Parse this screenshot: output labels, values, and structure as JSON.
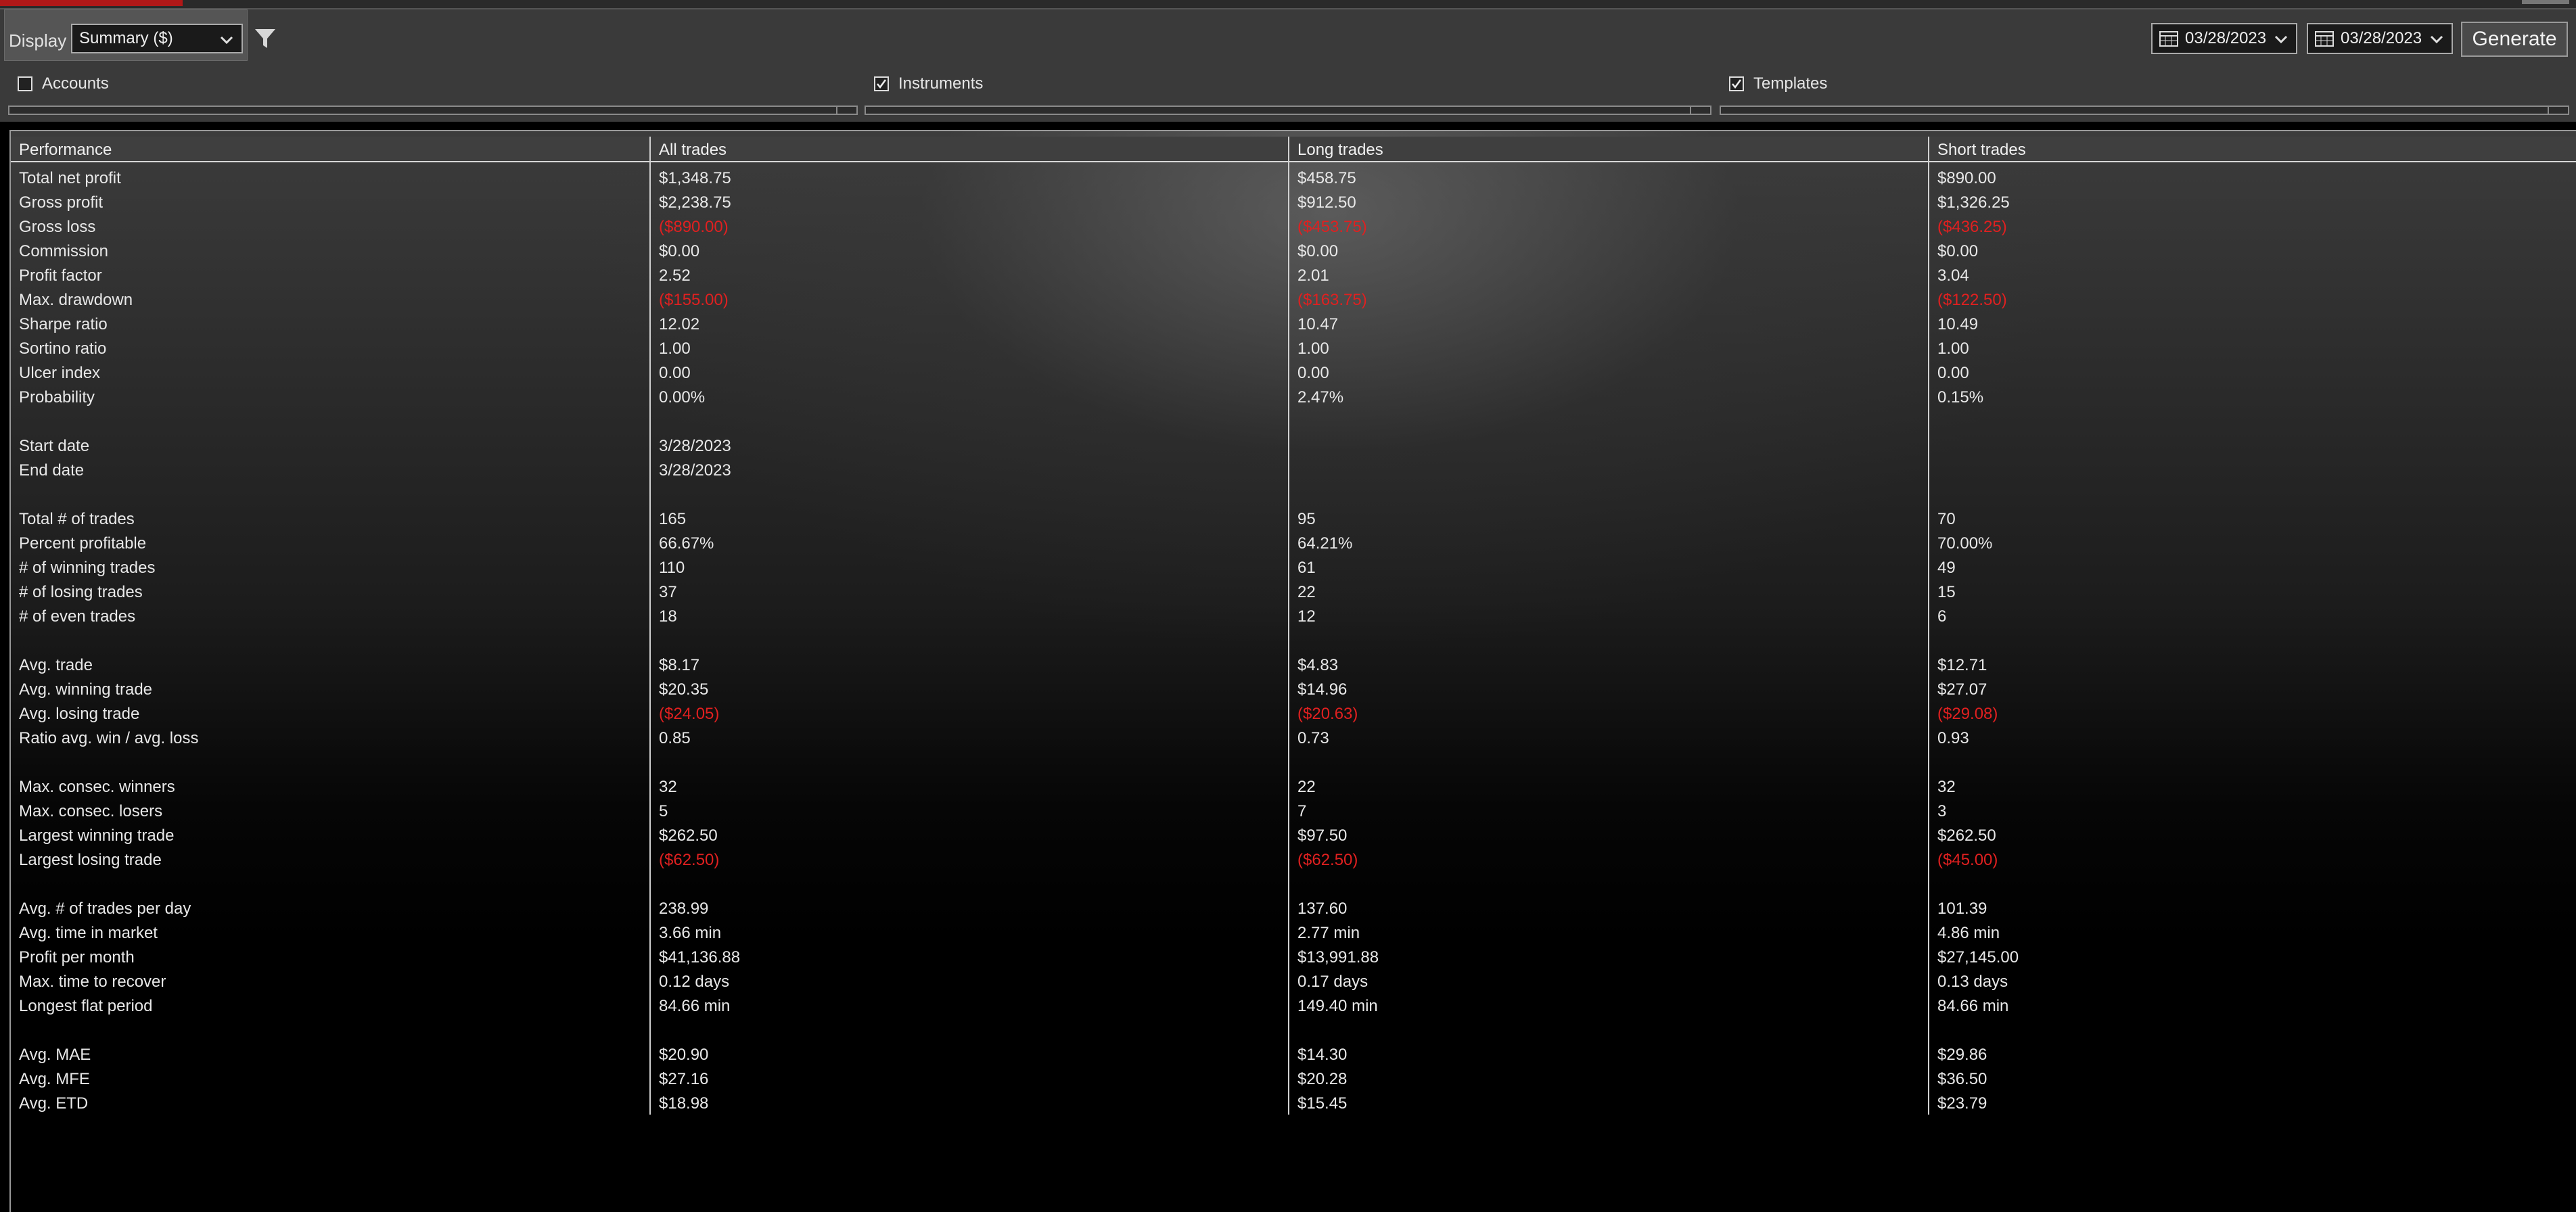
{
  "toolbar": {
    "display_label": "Display",
    "display_value": "Summary ($)",
    "date_from": "03/28/2023",
    "date_to": "03/28/2023",
    "generate_label": "Generate"
  },
  "filters": [
    {
      "label": "Accounts",
      "checked": false
    },
    {
      "label": "Instruments",
      "checked": true
    },
    {
      "label": "Templates",
      "checked": true
    }
  ],
  "grid": {
    "columns": [
      "Performance",
      "All trades",
      "Long trades",
      "Short trades"
    ],
    "rows": [
      {
        "label": "Total net profit",
        "cells": [
          {
            "v": "$1,348.75"
          },
          {
            "v": "$458.75"
          },
          {
            "v": "$890.00"
          }
        ]
      },
      {
        "label": "Gross profit",
        "cells": [
          {
            "v": "$2,238.75"
          },
          {
            "v": "$912.50"
          },
          {
            "v": "$1,326.25"
          }
        ]
      },
      {
        "label": "Gross loss",
        "cells": [
          {
            "v": "($890.00)",
            "neg": true
          },
          {
            "v": "($453.75)",
            "neg": true
          },
          {
            "v": "($436.25)",
            "neg": true
          }
        ]
      },
      {
        "label": "Commission",
        "cells": [
          {
            "v": "$0.00"
          },
          {
            "v": "$0.00"
          },
          {
            "v": "$0.00"
          }
        ]
      },
      {
        "label": "Profit factor",
        "cells": [
          {
            "v": "2.52"
          },
          {
            "v": "2.01"
          },
          {
            "v": "3.04"
          }
        ]
      },
      {
        "label": "Max. drawdown",
        "cells": [
          {
            "v": "($155.00)",
            "neg": true
          },
          {
            "v": "($163.75)",
            "neg": true
          },
          {
            "v": "($122.50)",
            "neg": true
          }
        ]
      },
      {
        "label": "Sharpe ratio",
        "cells": [
          {
            "v": "12.02"
          },
          {
            "v": "10.47"
          },
          {
            "v": "10.49"
          }
        ]
      },
      {
        "label": "Sortino ratio",
        "cells": [
          {
            "v": "1.00"
          },
          {
            "v": "1.00"
          },
          {
            "v": "1.00"
          }
        ]
      },
      {
        "label": "Ulcer index",
        "cells": [
          {
            "v": "0.00"
          },
          {
            "v": "0.00"
          },
          {
            "v": "0.00"
          }
        ]
      },
      {
        "label": "Probability",
        "cells": [
          {
            "v": "0.00%"
          },
          {
            "v": "2.47%"
          },
          {
            "v": "0.15%"
          }
        ]
      },
      {
        "label": "",
        "cells": [
          {
            "v": ""
          },
          {
            "v": ""
          },
          {
            "v": ""
          }
        ]
      },
      {
        "label": "Start date",
        "cells": [
          {
            "v": "3/28/2023"
          },
          {
            "v": ""
          },
          {
            "v": ""
          }
        ]
      },
      {
        "label": "End date",
        "cells": [
          {
            "v": "3/28/2023"
          },
          {
            "v": ""
          },
          {
            "v": ""
          }
        ]
      },
      {
        "label": "",
        "cells": [
          {
            "v": ""
          },
          {
            "v": ""
          },
          {
            "v": ""
          }
        ]
      },
      {
        "label": "Total # of trades",
        "cells": [
          {
            "v": "165"
          },
          {
            "v": "95"
          },
          {
            "v": "70"
          }
        ]
      },
      {
        "label": "Percent profitable",
        "cells": [
          {
            "v": "66.67%"
          },
          {
            "v": "64.21%"
          },
          {
            "v": "70.00%"
          }
        ]
      },
      {
        "label": "# of winning trades",
        "cells": [
          {
            "v": "110"
          },
          {
            "v": "61"
          },
          {
            "v": "49"
          }
        ]
      },
      {
        "label": "# of losing trades",
        "cells": [
          {
            "v": "37"
          },
          {
            "v": "22"
          },
          {
            "v": "15"
          }
        ]
      },
      {
        "label": "# of even trades",
        "cells": [
          {
            "v": "18"
          },
          {
            "v": "12"
          },
          {
            "v": "6"
          }
        ]
      },
      {
        "label": "",
        "cells": [
          {
            "v": ""
          },
          {
            "v": ""
          },
          {
            "v": ""
          }
        ]
      },
      {
        "label": "Avg. trade",
        "cells": [
          {
            "v": "$8.17"
          },
          {
            "v": "$4.83"
          },
          {
            "v": "$12.71"
          }
        ]
      },
      {
        "label": "Avg. winning trade",
        "cells": [
          {
            "v": "$20.35"
          },
          {
            "v": "$14.96"
          },
          {
            "v": "$27.07"
          }
        ]
      },
      {
        "label": "Avg. losing trade",
        "cells": [
          {
            "v": "($24.05)",
            "neg": true
          },
          {
            "v": "($20.63)",
            "neg": true
          },
          {
            "v": "($29.08)",
            "neg": true
          }
        ]
      },
      {
        "label": "Ratio avg. win / avg. loss",
        "cells": [
          {
            "v": "0.85"
          },
          {
            "v": "0.73"
          },
          {
            "v": "0.93"
          }
        ]
      },
      {
        "label": "",
        "cells": [
          {
            "v": ""
          },
          {
            "v": ""
          },
          {
            "v": ""
          }
        ]
      },
      {
        "label": "Max. consec. winners",
        "cells": [
          {
            "v": "32"
          },
          {
            "v": "22"
          },
          {
            "v": "32"
          }
        ]
      },
      {
        "label": "Max. consec. losers",
        "cells": [
          {
            "v": "5"
          },
          {
            "v": "7"
          },
          {
            "v": "3"
          }
        ]
      },
      {
        "label": "Largest winning trade",
        "cells": [
          {
            "v": "$262.50"
          },
          {
            "v": "$97.50"
          },
          {
            "v": "$262.50"
          }
        ]
      },
      {
        "label": "Largest losing trade",
        "cells": [
          {
            "v": "($62.50)",
            "neg": true
          },
          {
            "v": "($62.50)",
            "neg": true
          },
          {
            "v": "($45.00)",
            "neg": true
          }
        ]
      },
      {
        "label": "",
        "cells": [
          {
            "v": ""
          },
          {
            "v": ""
          },
          {
            "v": ""
          }
        ]
      },
      {
        "label": "Avg. # of trades per day",
        "cells": [
          {
            "v": "238.99"
          },
          {
            "v": "137.60"
          },
          {
            "v": "101.39"
          }
        ]
      },
      {
        "label": "Avg. time in market",
        "cells": [
          {
            "v": "3.66 min"
          },
          {
            "v": "2.77 min"
          },
          {
            "v": "4.86 min"
          }
        ]
      },
      {
        "label": "Profit per month",
        "cells": [
          {
            "v": "$41,136.88"
          },
          {
            "v": "$13,991.88"
          },
          {
            "v": "$27,145.00"
          }
        ]
      },
      {
        "label": "Max. time to recover",
        "cells": [
          {
            "v": "0.12 days"
          },
          {
            "v": "0.17 days"
          },
          {
            "v": "0.13 days"
          }
        ]
      },
      {
        "label": "Longest flat period",
        "cells": [
          {
            "v": "84.66 min"
          },
          {
            "v": "149.40 min"
          },
          {
            "v": "84.66 min"
          }
        ]
      },
      {
        "label": "",
        "cells": [
          {
            "v": ""
          },
          {
            "v": ""
          },
          {
            "v": ""
          }
        ]
      },
      {
        "label": "Avg. MAE",
        "cells": [
          {
            "v": "$20.90"
          },
          {
            "v": "$14.30"
          },
          {
            "v": "$29.86"
          }
        ]
      },
      {
        "label": "Avg. MFE",
        "cells": [
          {
            "v": "$27.16"
          },
          {
            "v": "$20.28"
          },
          {
            "v": "$36.50"
          }
        ]
      },
      {
        "label": "Avg. ETD",
        "cells": [
          {
            "v": "$18.98"
          },
          {
            "v": "$15.45"
          },
          {
            "v": "$23.79"
          }
        ]
      }
    ]
  },
  "colors": {
    "negative": "#e02020",
    "text": "#e8e8e8"
  }
}
